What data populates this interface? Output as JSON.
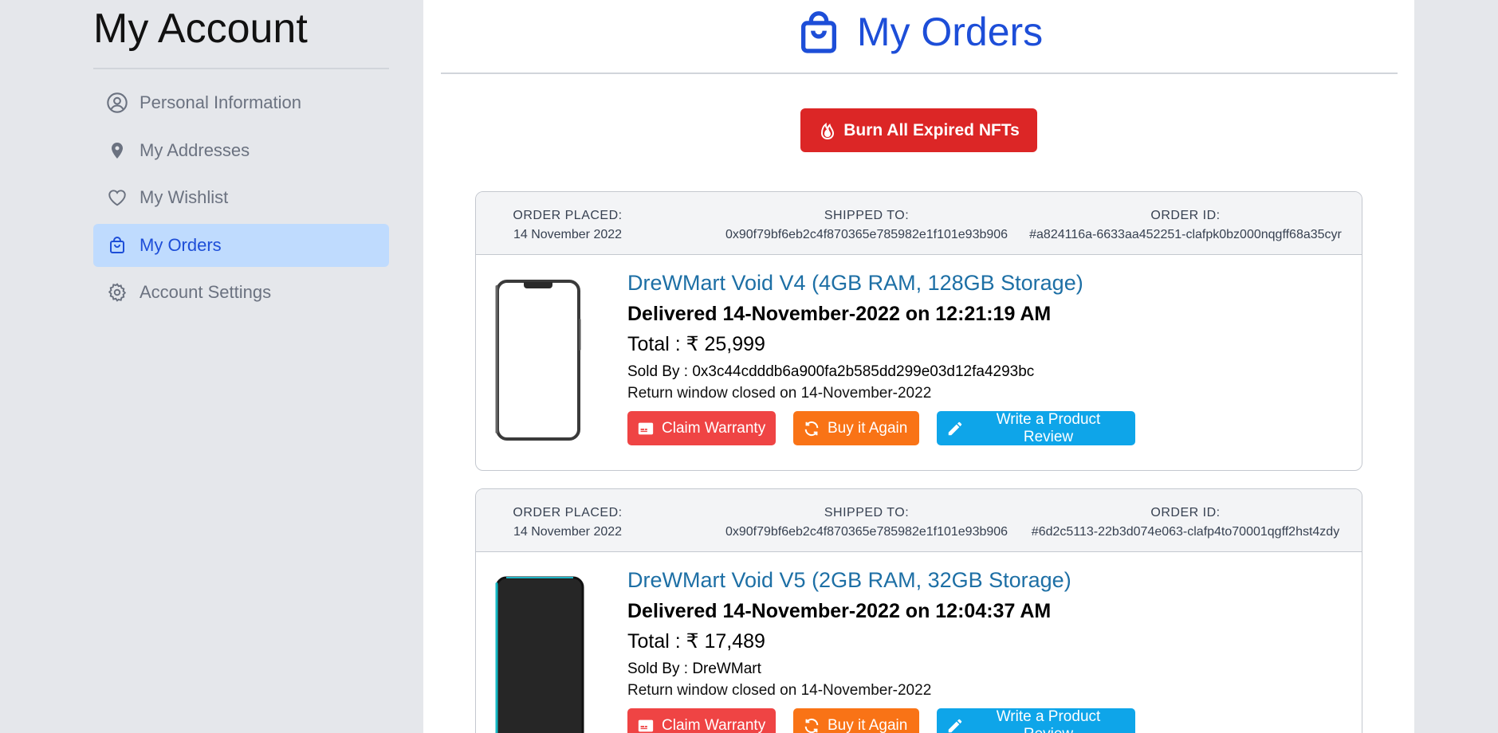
{
  "sidebar": {
    "title": "My Account",
    "items": [
      {
        "label": "Personal Information",
        "icon": "user-circle-icon",
        "active": false
      },
      {
        "label": "My Addresses",
        "icon": "map-pin-icon",
        "active": false
      },
      {
        "label": "My Wishlist",
        "icon": "heart-icon",
        "active": false
      },
      {
        "label": "My Orders",
        "icon": "shopping-bag-icon",
        "active": true
      },
      {
        "label": "Account Settings",
        "icon": "gear-icon",
        "active": false
      }
    ]
  },
  "main": {
    "title": "My Orders",
    "title_icon": "shopping-bag-icon",
    "burn_button_label": "Burn All Expired NFTs",
    "burn_button_icon": "fire-icon"
  },
  "labels": {
    "order_placed": "ORDER PLACED:",
    "shipped_to": "SHIPPED TO:",
    "order_id": "ORDER ID:",
    "claim_warranty": "Claim Warranty",
    "buy_again": "Buy it Again",
    "write_review": "Write a Product Review"
  },
  "orders": [
    {
      "placed": "14 November 2022",
      "shipped_to": "0x90f79bf6eb2c4f870365e785982e1f101e93b906",
      "order_id": "#a824116a-6633aa452251-clafpk0bz000nqgff68a35cyr",
      "product": "DreWMart Void V4 (4GB RAM, 128GB Storage)",
      "delivered": "Delivered 14-November-2022 on 12:21:19 AM",
      "total": "Total : ₹ 25,999",
      "sold_by": "Sold By : 0x3c44cdddb6a900fa2b585dd299e03d12fa4293bc",
      "return_window": "Return window closed on 14-November-2022",
      "phone_color": "#ffffff"
    },
    {
      "placed": "14 November 2022",
      "shipped_to": "0x90f79bf6eb2c4f870365e785982e1f101e93b906",
      "order_id": "#6d2c5113-22b3d074e063-clafp4to70001qgff2hst4zdy",
      "product": "DreWMart Void V5 (2GB RAM, 32GB Storage)",
      "delivered": "Delivered 14-November-2022 on 12:04:37 AM",
      "total": "Total : ₹ 17,489",
      "sold_by": "Sold By : DreWMart",
      "return_window": "Return window closed on 14-November-2022",
      "phone_color": "#262626"
    }
  ],
  "colors": {
    "accent": "#1d4ed8",
    "active_nav_bg": "#bfdbfe",
    "burn_red": "#dc2626",
    "warranty_red": "#ef4444",
    "buy_orange": "#f97316",
    "review_sky": "#0ea5e9"
  }
}
